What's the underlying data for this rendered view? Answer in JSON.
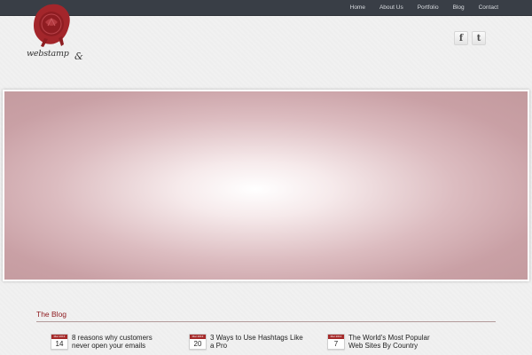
{
  "nav": {
    "items": [
      "Home",
      "About Us",
      "Portfolio",
      "Blog",
      "Contact"
    ]
  },
  "logo": {
    "text": "webstamp",
    "amp": "&"
  },
  "social": {
    "facebook_glyph": "f",
    "twitter_glyph": "t"
  },
  "blog": {
    "title": "The Blog",
    "posts": [
      {
        "month": "Mar 2013",
        "day": "14",
        "title": "8 reasons why customers never open your emails"
      },
      {
        "month": "Mar 2013",
        "day": "20",
        "title": "3 Ways to Use Hashtags Like a Pro"
      },
      {
        "month": "Mar 2013",
        "day": "7",
        "title": "The World's Most Popular Web Sites By Country"
      }
    ]
  },
  "colors": {
    "topbar": "#393e46",
    "accent": "#8f1e22",
    "seal": "#a3262b"
  }
}
